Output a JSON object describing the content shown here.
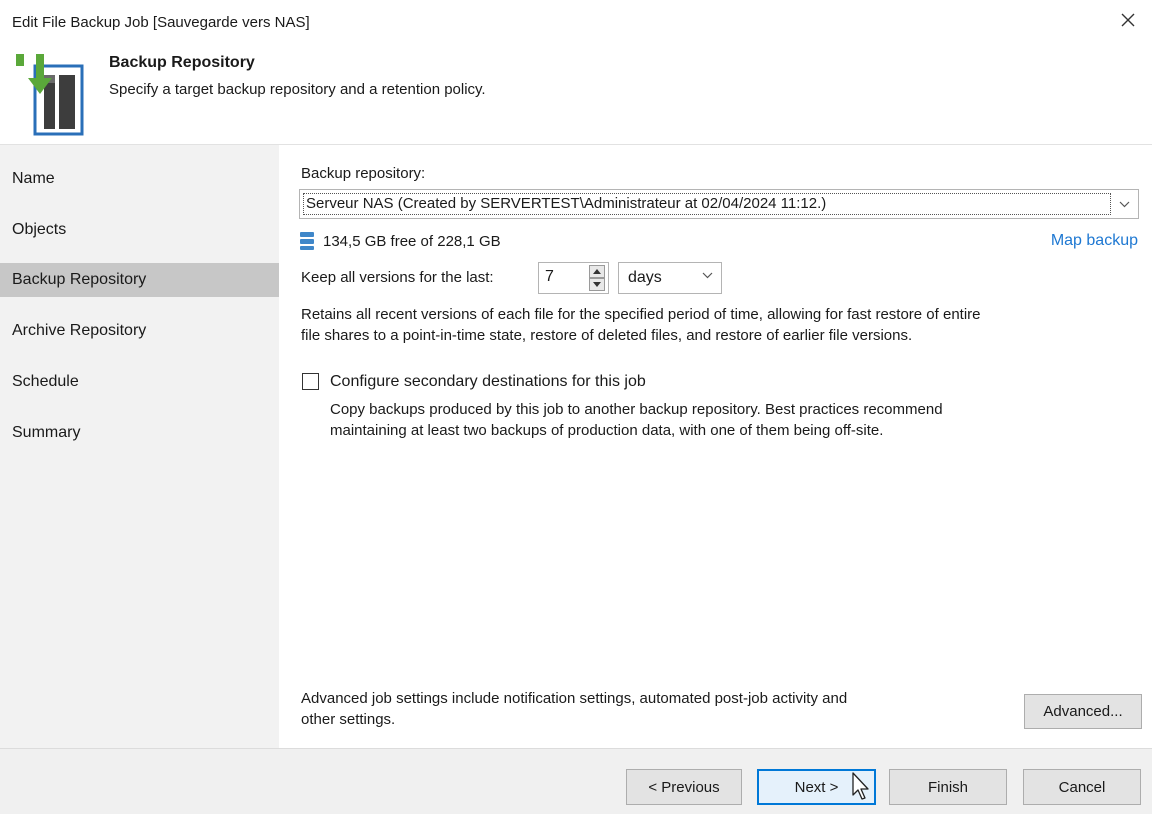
{
  "window": {
    "title": "Edit File Backup Job [Sauvegarde vers NAS]",
    "close_icon": "close-icon"
  },
  "header": {
    "title": "Backup Repository",
    "subtitle": "Specify a target backup repository and a retention policy.",
    "icon": "backup-repository-icon"
  },
  "nav": {
    "items": [
      {
        "label": "Name",
        "active": false
      },
      {
        "label": "Objects",
        "active": false
      },
      {
        "label": "Backup Repository",
        "active": true
      },
      {
        "label": "Archive Repository",
        "active": false
      },
      {
        "label": "Schedule",
        "active": false
      },
      {
        "label": "Summary",
        "active": false
      }
    ]
  },
  "main": {
    "repository_label": "Backup repository:",
    "repository_value": "Serveur NAS (Created by SERVERTEST\\Administrateur at 02/04/2024 11:12.)",
    "free_space": "134,5 GB free of 228,1 GB",
    "map_backup_link": "Map backup",
    "keep_versions_label": "Keep all versions for the last:",
    "keep_versions_value": "7",
    "keep_versions_unit": "days",
    "retention_desc_line1": "Retains all recent versions of each file for the specified period of time, allowing for fast restore of entire",
    "retention_desc_line2": "file shares to a point-in-time state, restore of deleted files, and restore of earlier file versions.",
    "secondary_checkbox_label": "Configure secondary destinations for this job",
    "secondary_checked": false,
    "secondary_desc_line1": "Copy backups produced by this job to another backup repository. Best practices recommend",
    "secondary_desc_line2": "maintaining at least two backups of production data, with one of them being off-site.",
    "advanced_desc_line1": "Advanced job settings include notification settings, automated post-job activity and",
    "advanced_desc_line2": "other settings.",
    "advanced_button": "Advanced..."
  },
  "footer": {
    "previous_button": "< Previous",
    "next_button": "Next >",
    "finish_button": "Finish",
    "cancel_button": "Cancel"
  },
  "colors": {
    "accent": "#1e78d2",
    "icon_green": "#5aa83a",
    "icon_blue": "#2a6fb8",
    "nav_active": "#c7c7c7",
    "sidebar_bg": "#f2f2f2"
  }
}
